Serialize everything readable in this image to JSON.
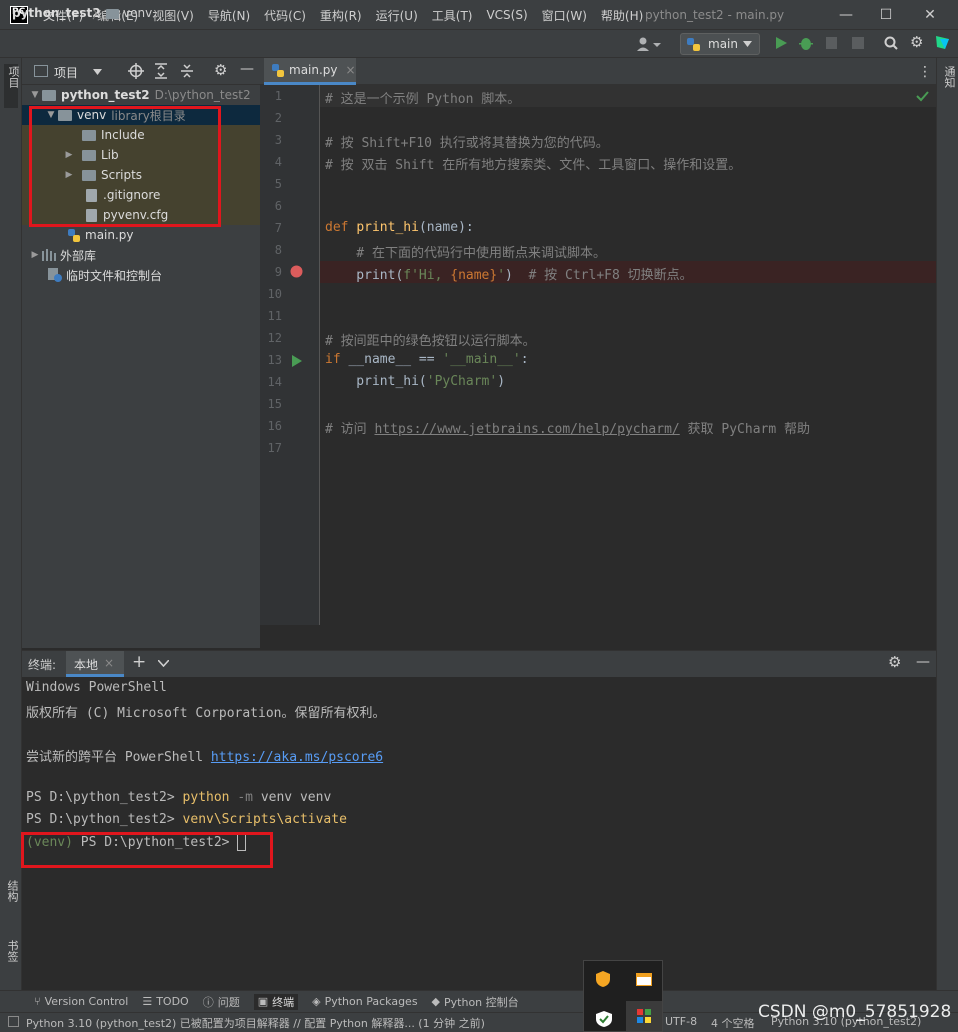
{
  "app": {
    "logo": "PC",
    "window_title": "python_test2 - main.py"
  },
  "menu": [
    "文件(F)",
    "编辑(E)",
    "视图(V)",
    "导航(N)",
    "代码(C)",
    "重构(R)",
    "运行(U)",
    "工具(T)",
    "VCS(S)",
    "窗口(W)",
    "帮助(H)"
  ],
  "window_controls": {
    "minimize": "—",
    "maximize": "☐",
    "close": "✕"
  },
  "breadcrumb": {
    "project": "python_test2",
    "sep": "〉",
    "folder": "venv"
  },
  "run_config": {
    "name": "main"
  },
  "left_strip": {
    "project": "项目",
    "structure": "结构",
    "bookmarks": "书签"
  },
  "right_strip": {
    "notifications": "通知"
  },
  "project_panel": {
    "title": "项目",
    "tree": [
      {
        "label": "python_test2",
        "hint": "D:\\python_test2"
      },
      {
        "label": "venv",
        "hint": "library根目录"
      },
      {
        "label": "Include"
      },
      {
        "label": "Lib"
      },
      {
        "label": "Scripts"
      },
      {
        "label": ".gitignore"
      },
      {
        "label": "pyvenv.cfg"
      },
      {
        "label": "main.py"
      },
      {
        "label": "外部库"
      },
      {
        "label": "临时文件和控制台"
      }
    ]
  },
  "editor": {
    "tab": "main.py",
    "tab_close": "×",
    "line_numbers": [
      "1",
      "2",
      "3",
      "4",
      "5",
      "6",
      "7",
      "8",
      "9",
      "10",
      "11",
      "12",
      "13",
      "14",
      "15",
      "16",
      "17"
    ],
    "code": {
      "l1": "# 这是一个示例 Python 脚本。",
      "l3": "# 按 Shift+F10 执行或将其替换为您的代码。",
      "l4": "# 按 双击 Shift 在所有地方搜索类、文件、工具窗口、操作和设置。",
      "l7_kw": "def",
      "l7_fn": "print_hi",
      "l7_rest": "(name):",
      "l8": "    # 在下面的代码行中使用断点来调试脚本。",
      "l9_a": "    print(",
      "l9_str": "f'Hi, ",
      "l9_var": "{name}",
      "l9_str2": "'",
      "l9_b": ")  ",
      "l9_cm": "# 按 Ctrl+F8 切换断点。",
      "l12": "# 按间距中的绿色按钮以运行脚本。",
      "l13_kw": "if",
      "l13_a": " __name__ == ",
      "l13_str": "'__main__'",
      "l13_b": ":",
      "l14_a": "    print_hi(",
      "l14_str": "'PyCharm'",
      "l14_b": ")",
      "l16_a": "# 访问 ",
      "l16_link": "https://www.jetbrains.com/help/pycharm/",
      "l16_b": " 获取 PyCharm 帮助"
    }
  },
  "terminal": {
    "label": "终端:",
    "tab": "本地",
    "tab_close": "×",
    "add": "+",
    "lines": {
      "t1": "Windows PowerShell",
      "t2": "版权所有 (C) Microsoft Corporation。保留所有权利。",
      "t4a": "尝试新的跨平台 PowerShell ",
      "t4link": "https://aka.ms/pscore6",
      "t6a": "PS D:\\python_test2> ",
      "t6b": "python",
      "t6c": " -m",
      "t6d": " venv venv",
      "t7a": "PS D:\\python_test2> ",
      "t7b": "venv\\Scripts\\activate",
      "t8a": "(venv)",
      "t8b": " PS D:\\python_test2> "
    }
  },
  "tool_windows": [
    "Version Control",
    "TODO",
    "问题",
    "终端",
    "Python Packages",
    "Python 控制台"
  ],
  "status": {
    "message": "Python 3.10 (python_test2) 已被配置为项目解释器 // 配置 Python 解释器... (1 分钟 之前)",
    "encoding": "UTF-8",
    "indent": "4 个空格",
    "interpreter": "Python 3.10 (python_test2)",
    "watermark": "CSDN @m0_57851928"
  },
  "colors": {
    "breakpoint": "#db5c5c",
    "run": "#499c54",
    "highlight_box": "#e0161d"
  }
}
